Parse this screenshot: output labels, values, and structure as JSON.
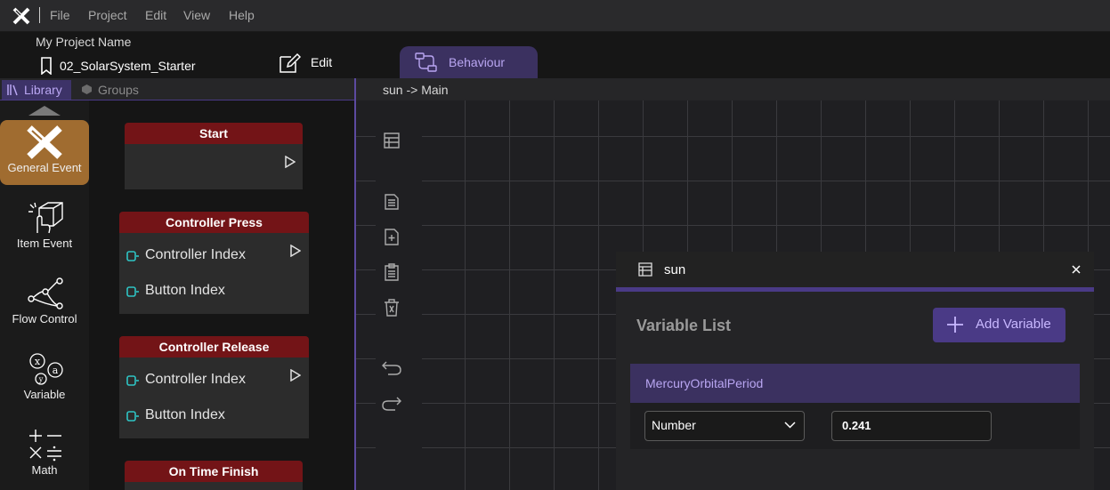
{
  "menubar": {
    "items": [
      "File",
      "Project",
      "Edit",
      "View",
      "Help"
    ]
  },
  "project": {
    "name": "My Project Name",
    "file": "02_SolarSystem_Starter",
    "edit_label": "Edit",
    "behaviour_tab": "Behaviour"
  },
  "library": {
    "tabs": [
      "Library",
      "Groups"
    ],
    "categories": [
      "General Event",
      "Item Event",
      "Flow Control",
      "Variable",
      "Math"
    ],
    "nodes": [
      {
        "title": "Start",
        "ports": []
      },
      {
        "title": "Controller Press",
        "ports": [
          "Controller Index",
          "Button Index"
        ]
      },
      {
        "title": "Controller Release",
        "ports": [
          "Controller Index",
          "Button Index"
        ]
      },
      {
        "title": "On Time Finish",
        "ports": []
      }
    ]
  },
  "canvas": {
    "breadcrumb": "sun -> Main"
  },
  "variables_panel": {
    "title": "sun",
    "heading": "Variable List",
    "add_button": "Add Variable",
    "variable": {
      "name": "MercuryOrbitalPeriod",
      "type": "Number",
      "value": "0.241"
    }
  },
  "colors": {
    "accent": "#4a3a86",
    "node_header": "#731417",
    "active_category": "#a06c30"
  }
}
